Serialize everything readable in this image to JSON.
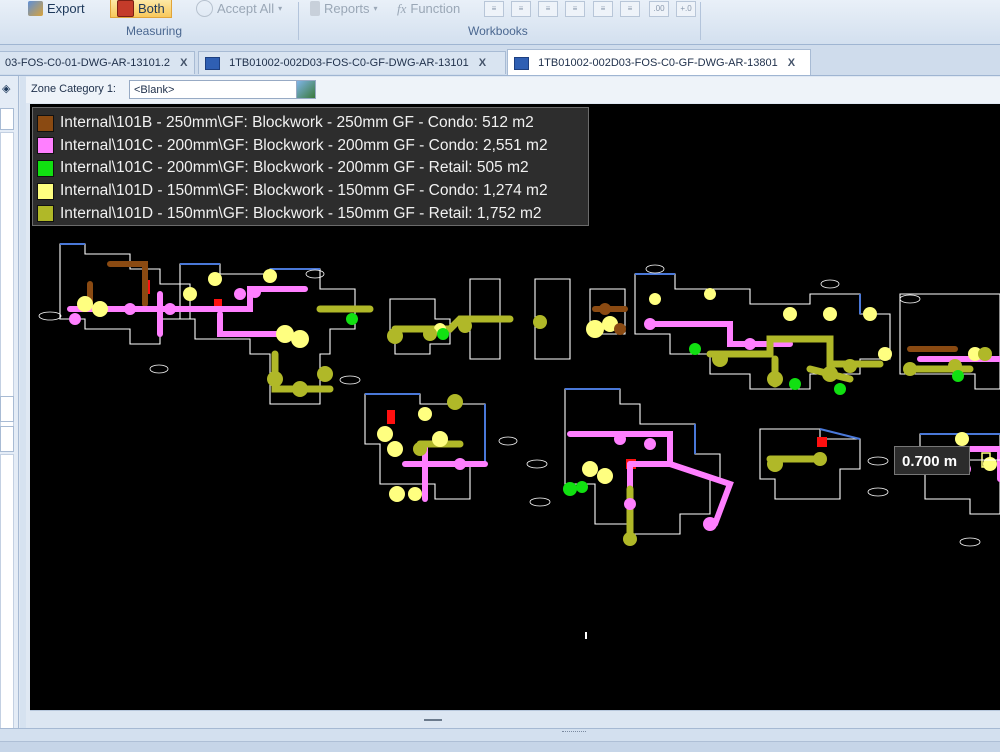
{
  "ribbon": {
    "export_label": "Export",
    "both_label": "Both",
    "accept_all_label": "Accept All",
    "reports_label": "Reports",
    "function_label": "Function",
    "group_measuring": "Measuring",
    "group_workbooks": "Workbooks",
    "mini_buttons": [
      ".00",
      "+.0"
    ]
  },
  "tabs": [
    {
      "label": "03-FOS-C0-01-DWG-AR-13101.2",
      "active": false
    },
    {
      "label": "1TB01002-002D03-FOS-C0-GF-DWG-AR-13101",
      "active": false
    },
    {
      "label": "1TB01002-002D03-FOS-C0-GF-DWG-AR-13801",
      "active": true
    }
  ],
  "tab_close_glyph": "X",
  "zone": {
    "label": "Zone Category 1:",
    "value": "<Blank>"
  },
  "legend": [
    {
      "text": "Internal\\101B - 250mm\\GF: Blockwork - 250mm GF - Condo: 512 m2",
      "color": "#8a4a12"
    },
    {
      "text": "Internal\\101C - 200mm\\GF: Blockwork - 200mm GF - Condo: 2,551 m2",
      "color": "#ff7fff"
    },
    {
      "text": "Internal\\101C - 200mm\\GF: Blockwork - 200mm GF - Retail: 505 m2",
      "color": "#11e011"
    },
    {
      "text": "Internal\\101D - 150mm\\GF: Blockwork - 150mm GF - Condo: 1,274 m2",
      "color": "#ffff80"
    },
    {
      "text": "Internal\\101D - 150mm\\GF: Blockwork - 150mm GF - Retail: 1,752 m2",
      "color": "#b0b828"
    }
  ],
  "measurement": "0.700 m",
  "colors": {
    "condo_250": "#8a4a12",
    "condo_200": "#ff7fff",
    "retail_200": "#11e011",
    "condo_150": "#ffff80",
    "retail_150": "#b0b828",
    "wall_line": "#ffffff",
    "wall_blue": "#4a78d8",
    "door_red": "#ff1010",
    "canvas_bg": "#000000"
  }
}
